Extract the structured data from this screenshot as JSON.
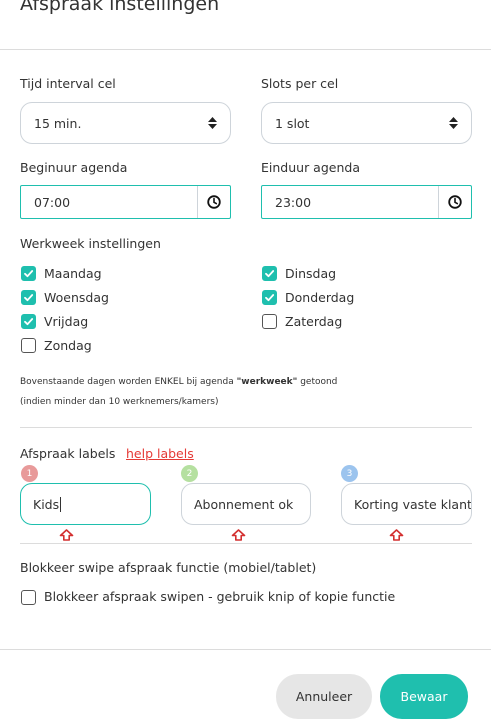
{
  "modal": {
    "title": "Afspraak instellingen"
  },
  "interval": {
    "label": "Tijd interval cel",
    "value": "15 min."
  },
  "slots": {
    "label": "Slots per cel",
    "value": "1 slot"
  },
  "begin": {
    "label": "Beginuur agenda",
    "value": "07:00"
  },
  "end": {
    "label": "Einduur agenda",
    "value": "23:00"
  },
  "workweek": {
    "label": "Werkweek instellingen",
    "days": [
      {
        "label": "Maandag",
        "checked": true
      },
      {
        "label": "Dinsdag",
        "checked": true
      },
      {
        "label": "Woensdag",
        "checked": true
      },
      {
        "label": "Donderdag",
        "checked": true
      },
      {
        "label": "Vrijdag",
        "checked": true
      },
      {
        "label": "Zaterdag",
        "checked": false
      },
      {
        "label": "Zondag",
        "checked": false
      }
    ],
    "note1_pre": "Bovenstaande dagen worden ENKEL bij agenda ",
    "note1_bold": "\"werkweek\"",
    "note1_post": " getoond",
    "note2": "(indien minder dan 10 werknemers/kamers)"
  },
  "labels": {
    "title": "Afspraak labels",
    "help_link": "help labels",
    "items": [
      {
        "number": "1",
        "value": "Kids",
        "badge_color": "#e89a9a"
      },
      {
        "number": "2",
        "value": "Abonnement ok",
        "badge_color": "#b5e0a0"
      },
      {
        "number": "3",
        "value": "Korting vaste klant",
        "badge_color": "#9cc4ee"
      }
    ]
  },
  "swipe": {
    "title": "Blokkeer swipe afspraak functie (mobiel/tablet)",
    "checkbox_label": "Blokkeer afspraak swipen - gebruik knip of kopie functie",
    "checked": false
  },
  "footer": {
    "cancel": "Annuleer",
    "save": "Bewaar"
  },
  "colors": {
    "accent": "#1fbfae",
    "link": "#e53935",
    "arrow": "#d32f2f"
  }
}
